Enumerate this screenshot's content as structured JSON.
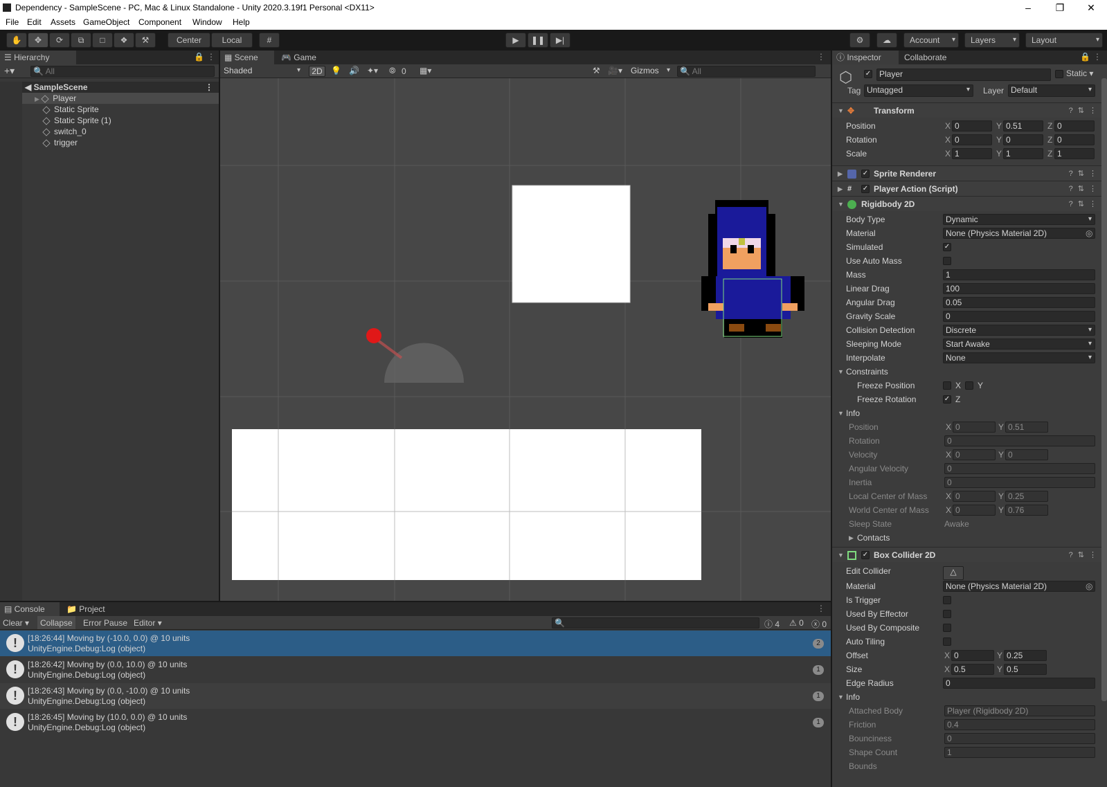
{
  "window": {
    "title": "Dependency - SampleScene - PC, Mac & Linux Standalone - Unity 2020.3.19f1 Personal <DX11>"
  },
  "menu": [
    "File",
    "Edit",
    "Assets",
    "GameObject",
    "Component",
    "Window",
    "Help"
  ],
  "toolbar": {
    "center": "Center",
    "local": "Local",
    "account": "Account",
    "layers": "Layers",
    "layout": "Layout"
  },
  "hierarchy": {
    "tab": "Hierarchy",
    "search_placeholder": "All",
    "scene": "SampleScene",
    "items": [
      "Player",
      "Static Sprite",
      "Static Sprite (1)",
      "switch_0",
      "trigger"
    ]
  },
  "scene_view": {
    "tabs": [
      "Scene",
      "Game"
    ],
    "shading": "Shaded",
    "mode_2d": "2D",
    "hidden_count": "0",
    "gizmos": "Gizmos",
    "search_placeholder": "All"
  },
  "console": {
    "tabs": [
      "Console",
      "Project"
    ],
    "buttons": [
      "Clear",
      "Collapse",
      "Error Pause",
      "Editor"
    ],
    "counts": {
      "log": "4",
      "warn": "0",
      "error": "0"
    },
    "entries": [
      {
        "line1": "[18:26:44] Moving by (-10.0, 0.0) @ 10 units",
        "line2": "UnityEngine.Debug:Log (object)",
        "count": "2",
        "selected": true
      },
      {
        "line1": "[18:26:42] Moving by (0.0, 10.0) @ 10 units",
        "line2": "UnityEngine.Debug:Log (object)",
        "count": "1"
      },
      {
        "line1": "[18:26:43] Moving by (0.0, -10.0) @ 10 units",
        "line2": "UnityEngine.Debug:Log (object)",
        "count": "1"
      },
      {
        "line1": "[18:26:45] Moving by (10.0, 0.0) @ 10 units",
        "line2": "UnityEngine.Debug:Log (object)",
        "count": "1"
      }
    ]
  },
  "inspector": {
    "tabs": [
      "Inspector",
      "Collaborate"
    ],
    "object_name": "Player",
    "static_label": "Static",
    "tag_label": "Tag",
    "tag": "Untagged",
    "layer_label": "Layer",
    "layer": "Default",
    "transform": {
      "title": "Transform",
      "position": {
        "label": "Position",
        "x": "0",
        "y": "0.51",
        "z": "0"
      },
      "rotation": {
        "label": "Rotation",
        "x": "0",
        "y": "0",
        "z": "0"
      },
      "scale": {
        "label": "Scale",
        "x": "1",
        "y": "1",
        "z": "1"
      }
    },
    "sprite_renderer": "Sprite Renderer",
    "player_action": "Player Action (Script)",
    "rigidbody": {
      "title": "Rigidbody 2D",
      "body_type": [
        "Body Type",
        "Dynamic"
      ],
      "material": [
        "Material",
        "None (Physics Material 2D)"
      ],
      "simulated": "Simulated",
      "use_auto_mass": "Use Auto Mass",
      "mass": [
        "Mass",
        "1"
      ],
      "linear_drag": [
        "Linear Drag",
        "100"
      ],
      "angular_drag": [
        "Angular Drag",
        "0.05"
      ],
      "gravity_scale": [
        "Gravity Scale",
        "0"
      ],
      "collision_detection": [
        "Collision Detection",
        "Discrete"
      ],
      "sleeping_mode": [
        "Sleeping Mode",
        "Start Awake"
      ],
      "interpolate": [
        "Interpolate",
        "None"
      ],
      "constraints": "Constraints",
      "freeze_position": "Freeze Position",
      "freeze_rotation": "Freeze Rotation",
      "info": "Info",
      "info_rows": {
        "position": [
          "Position",
          "0",
          "0.51"
        ],
        "rotation": [
          "Rotation",
          "0"
        ],
        "velocity": [
          "Velocity",
          "0",
          "0"
        ],
        "angular_velocity": [
          "Angular Velocity",
          "0"
        ],
        "inertia": [
          "Inertia",
          "0"
        ],
        "local_com": [
          "Local Center of Mass",
          "0",
          "0.25"
        ],
        "world_com": [
          "World Center of Mass",
          "0",
          "0.76"
        ],
        "sleep_state": [
          "Sleep State",
          "Awake"
        ]
      },
      "contacts": "Contacts"
    },
    "box_collider": {
      "title": "Box Collider 2D",
      "edit_collider": "Edit Collider",
      "material": [
        "Material",
        "None (Physics Material 2D)"
      ],
      "is_trigger": "Is Trigger",
      "used_by_effector": "Used By Effector",
      "used_by_composite": "Used By Composite",
      "auto_tiling": "Auto Tiling",
      "offset": [
        "Offset",
        "0",
        "0.25"
      ],
      "size": [
        "Size",
        "0.5",
        "0.5"
      ],
      "edge_radius": [
        "Edge Radius",
        "0"
      ],
      "info": "Info",
      "attached_body": [
        "Attached Body",
        "Player (Rigidbody 2D)"
      ],
      "friction": [
        "Friction",
        "0.4"
      ],
      "bounciness": [
        "Bounciness",
        "0"
      ],
      "shape_count": [
        "Shape Count",
        "1"
      ],
      "bounds": "Bounds"
    }
  },
  "axis": {
    "x": "X",
    "y": "Y",
    "z": "Z"
  }
}
